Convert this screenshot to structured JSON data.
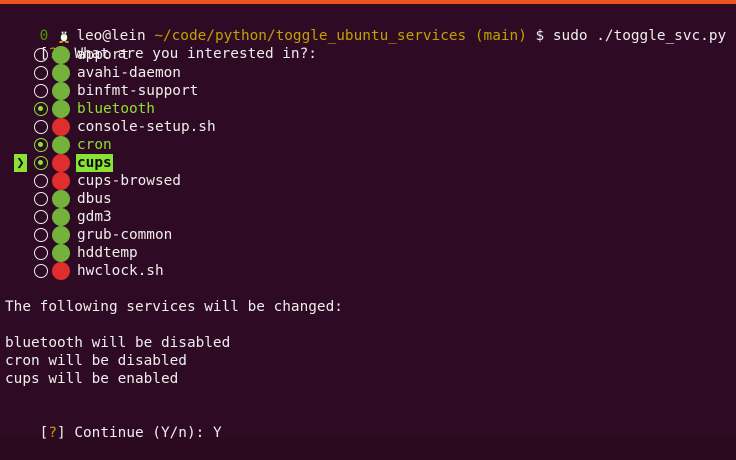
{
  "prompt": {
    "exit_code": "0",
    "user_host": "leo@lein",
    "cwd": "~/code/python/toggle_ubuntu_services",
    "branch": "(main)",
    "symbol": "$",
    "command": "sudo ./toggle_svc.py"
  },
  "question": {
    "bracket_open": "[",
    "mark": "?",
    "bracket_close": "]",
    "text": " What are you interested in?:"
  },
  "menu": {
    "pointer": "❯",
    "items": [
      {
        "label": "apport",
        "checked": false,
        "status": "green",
        "current": false
      },
      {
        "label": "avahi-daemon",
        "checked": false,
        "status": "green",
        "current": false
      },
      {
        "label": "binfmt-support",
        "checked": false,
        "status": "green",
        "current": false
      },
      {
        "label": "bluetooth",
        "checked": true,
        "status": "green",
        "current": false
      },
      {
        "label": "console-setup.sh",
        "checked": false,
        "status": "red",
        "current": false
      },
      {
        "label": "cron",
        "checked": true,
        "status": "green",
        "current": false
      },
      {
        "label": "cups",
        "checked": true,
        "status": "red",
        "current": true
      },
      {
        "label": "cups-browsed",
        "checked": false,
        "status": "red",
        "current": false
      },
      {
        "label": "dbus",
        "checked": false,
        "status": "green",
        "current": false
      },
      {
        "label": "gdm3",
        "checked": false,
        "status": "green",
        "current": false
      },
      {
        "label": "grub-common",
        "checked": false,
        "status": "green",
        "current": false
      },
      {
        "label": "hddtemp",
        "checked": false,
        "status": "green",
        "current": false
      },
      {
        "label": "hwclock.sh",
        "checked": false,
        "status": "red",
        "current": false
      }
    ]
  },
  "summary": {
    "heading": "The following services will be changed:",
    "changes": [
      "bluetooth will be disabled",
      "cron will be disabled",
      "cups will be enabled"
    ]
  },
  "confirm": {
    "bracket_open": "[",
    "mark": "?",
    "bracket_close": "]",
    "text": " Continue (Y/n): ",
    "answer": "Y"
  },
  "colors": {
    "background": "#2f0a24",
    "accent_orange": "#e95420",
    "green": "#8ae234",
    "yellow": "#c4a000",
    "status_green": "#73b33c",
    "status_red": "#e02d2d"
  }
}
